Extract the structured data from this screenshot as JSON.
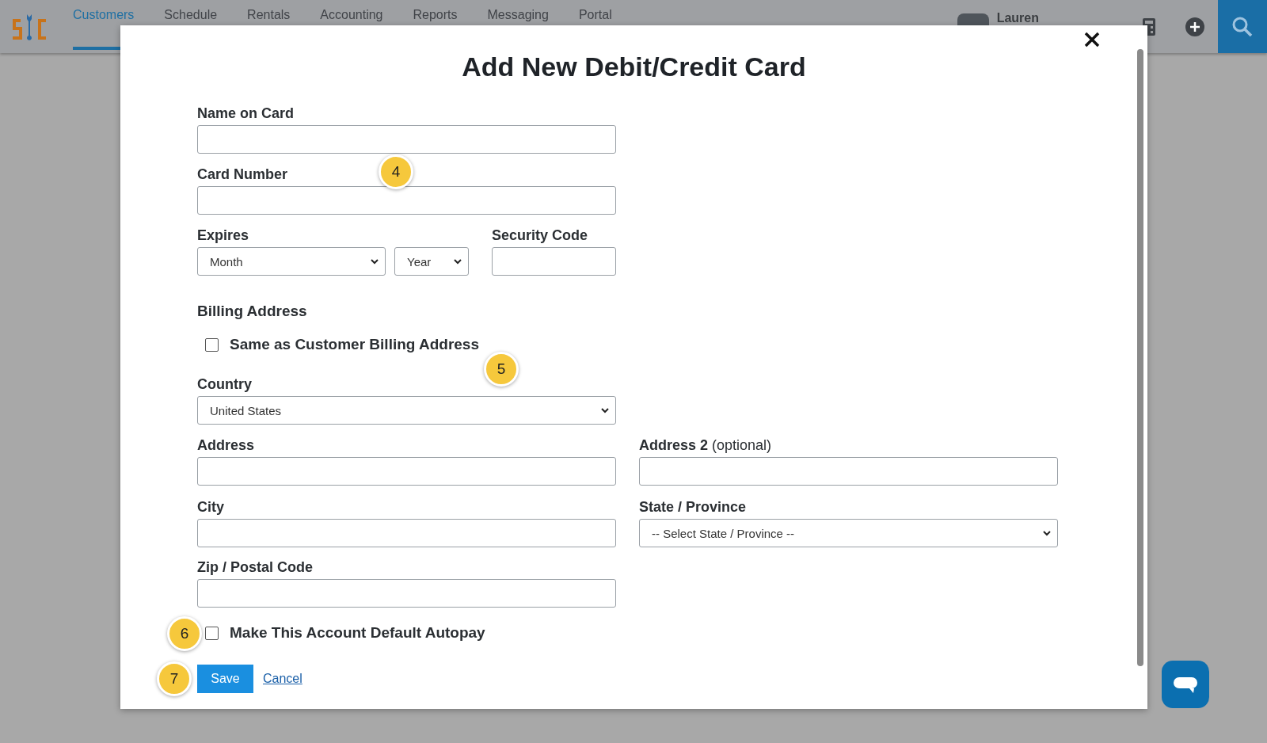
{
  "header": {
    "nav": [
      {
        "label": "Customers",
        "selected": true
      },
      {
        "label": "Schedule",
        "selected": false
      },
      {
        "label": "Rentals",
        "selected": false
      },
      {
        "label": "Accounting",
        "selected": false
      },
      {
        "label": "Reports",
        "selected": false
      },
      {
        "label": "Messaging",
        "selected": false
      },
      {
        "label": "Portal",
        "selected": false
      }
    ],
    "user": {
      "name": "Lauren"
    }
  },
  "modal": {
    "title": "Add New Debit/Credit Card",
    "name_on_card": {
      "label": "Name on Card"
    },
    "card_number": {
      "label": "Card Number"
    },
    "expires": {
      "label": "Expires",
      "month": "Month",
      "year": "Year"
    },
    "security_code": {
      "label": "Security Code"
    },
    "billing_heading": "Billing Address",
    "same_as_billing": {
      "label": "Same as Customer Billing Address",
      "checked": false
    },
    "country": {
      "label": "Country",
      "value": "United States"
    },
    "address": {
      "label": "Address"
    },
    "address2": {
      "label": "Address 2",
      "hint": "(optional)"
    },
    "city": {
      "label": "City"
    },
    "state": {
      "label": "State / Province",
      "value": "-- Select State / Province --"
    },
    "zip": {
      "label": "Zip / Postal Code"
    },
    "autopay": {
      "label": "Make This Account Default Autopay",
      "checked": false
    },
    "save": "Save",
    "cancel": "Cancel"
  },
  "callouts": [
    "4",
    "5",
    "6",
    "7"
  ]
}
